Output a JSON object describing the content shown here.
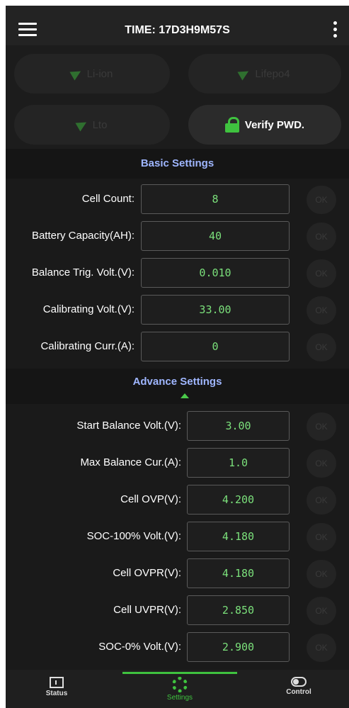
{
  "header": {
    "time": "TIME: 17D3H9M57S"
  },
  "battery_types": [
    {
      "label": "Li-ion"
    },
    {
      "label": "Lifepo4"
    },
    {
      "label": "Lto"
    }
  ],
  "verify_button": {
    "label": "Verify PWD."
  },
  "basic": {
    "title": "Basic Settings",
    "rows": [
      {
        "label": "Cell Count:",
        "value": "8",
        "ok": "OK"
      },
      {
        "label": "Battery Capacity(AH):",
        "value": "40",
        "ok": "OK"
      },
      {
        "label": "Balance Trig. Volt.(V):",
        "value": "0.010",
        "ok": "OK"
      },
      {
        "label": "Calibrating Volt.(V):",
        "value": "33.00",
        "ok": "OK"
      },
      {
        "label": "Calibrating Curr.(A):",
        "value": "0",
        "ok": "OK"
      }
    ]
  },
  "advance": {
    "title": "Advance Settings",
    "rows": [
      {
        "label": "Start Balance Volt.(V):",
        "value": "3.00",
        "ok": "OK"
      },
      {
        "label": "Max Balance Cur.(A):",
        "value": "1.0",
        "ok": "OK"
      },
      {
        "label": "Cell OVP(V):",
        "value": "4.200",
        "ok": "OK"
      },
      {
        "label": "SOC-100% Volt.(V):",
        "value": "4.180",
        "ok": "OK"
      },
      {
        "label": "Cell OVPR(V):",
        "value": "4.180",
        "ok": "OK"
      },
      {
        "label": "Cell UVPR(V):",
        "value": "2.850",
        "ok": "OK"
      },
      {
        "label": "SOC-0% Volt.(V):",
        "value": "2.900",
        "ok": "OK"
      }
    ]
  },
  "nav": {
    "status": "Status",
    "settings": "Settings",
    "control": "Control"
  },
  "colors": {
    "accent_green": "#3fc23f",
    "value_green": "#7be07b",
    "section_blue": "#9fb6ff"
  }
}
